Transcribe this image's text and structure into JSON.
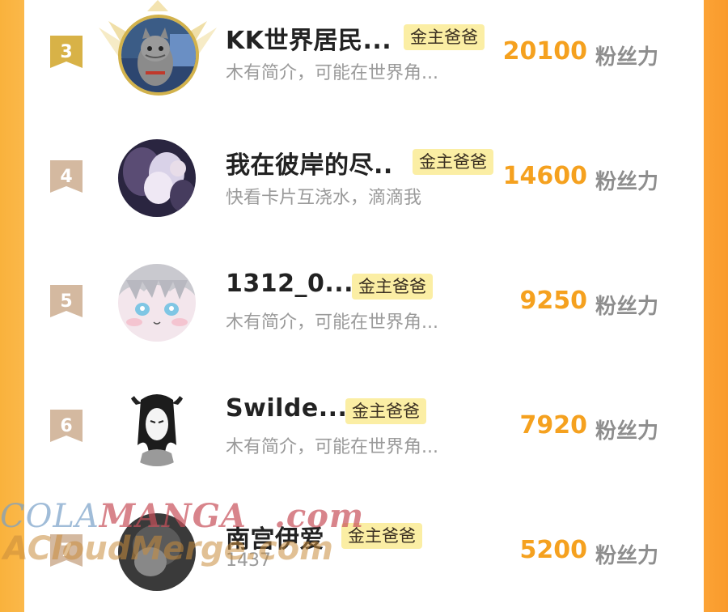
{
  "score_unit": "粉丝力",
  "rows": [
    {
      "rank": "3",
      "name": "KK世界居民...",
      "tag": "金主爸爸",
      "desc": "木有简介，可能在世界角...",
      "score": "20100",
      "badge_color": "#d8b247",
      "avatar": "cat"
    },
    {
      "rank": "4",
      "name": "我在彼岸的尽..",
      "tag": "金主爸爸",
      "desc": "快看卡片互浇水，滴滴我",
      "score": "14600",
      "badge_color": "#d4b9a0",
      "avatar": "hands"
    },
    {
      "rank": "5",
      "name": "1312_0...",
      "tag": "金主爸爸",
      "desc": "木有简介，可能在世界角...",
      "score": "9250",
      "badge_color": "#d4b9a0",
      "avatar": "anime-girl"
    },
    {
      "rank": "6",
      "name": "Swilde...",
      "tag": "金主爸爸",
      "desc": "木有简介，可能在世界角...",
      "score": "7920",
      "badge_color": "#d4b9a0",
      "avatar": "demon-sketch"
    },
    {
      "rank": "7",
      "name": "南宫伊爱",
      "tag": "金主爸爸",
      "desc": "1437",
      "score": "5200",
      "badge_color": "#d4b9a0",
      "avatar": "dark"
    }
  ],
  "watermark": {
    "line1_part1": "COLA",
    "line1_part2": "MANGA",
    "line1_part3": ".com",
    "line2": "ACloudMerge.com"
  }
}
